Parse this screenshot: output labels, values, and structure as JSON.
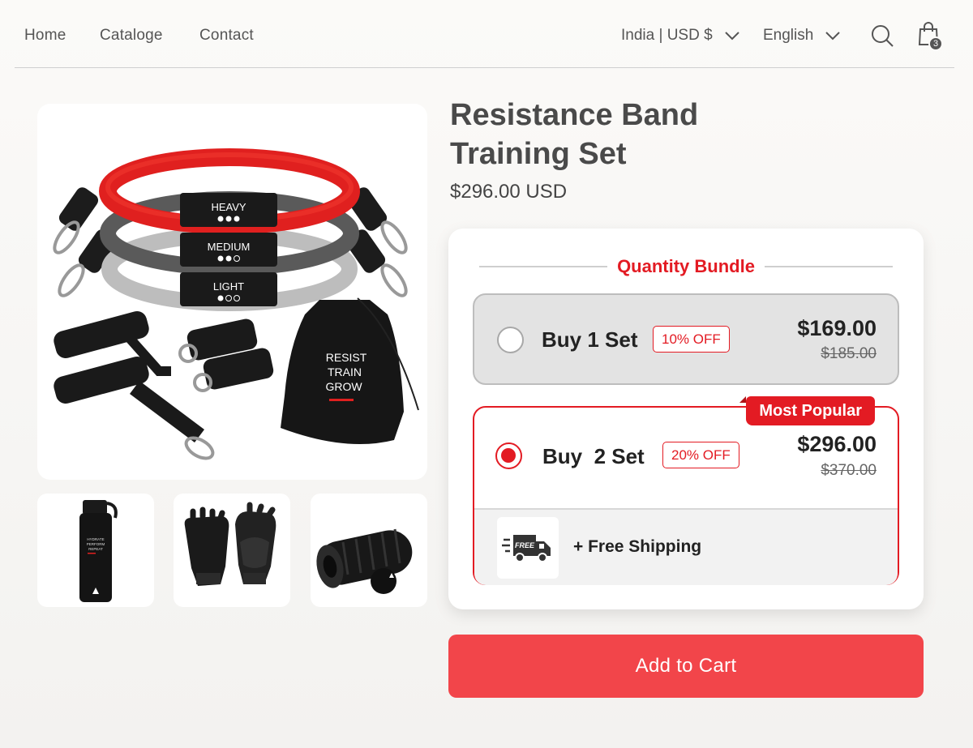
{
  "nav": {
    "links": [
      "Home",
      "Cataloge",
      "Contact"
    ],
    "region": "India | USD $",
    "language": "English",
    "cart_count": "3"
  },
  "gallery": {
    "main_image": "resistance-band-set-image",
    "band_labels": [
      "HEAVY",
      "MEDIUM",
      "LIGHT"
    ],
    "pouch_text": [
      "RESIST",
      "TRAIN",
      "GROW"
    ],
    "bottle_text": [
      "HYDRATE",
      "PERFORM",
      "REPEAT"
    ],
    "thumbnails": [
      "water-bottle-image",
      "gloves-image",
      "foam-roller-image"
    ]
  },
  "product": {
    "title_line1": "Resistance Band",
    "title_line2": "Training Set",
    "price": "$296.00 USD"
  },
  "bundle": {
    "heading": "Quantity Bundle",
    "options": [
      {
        "label": "Buy 1 Set",
        "discount": "10% OFF",
        "price": "$169.00",
        "old_price": "$185.00",
        "selected": false
      },
      {
        "label": "Buy  2 Set",
        "discount": "20% OFF",
        "price": "$296.00",
        "old_price": "$370.00",
        "selected": true,
        "badge": "Most Popular",
        "shipping_icon_text": "FREE",
        "shipping": "+ Free Shipping"
      }
    ]
  },
  "colors": {
    "accent": "#e31b23",
    "button": "#f2454a"
  },
  "add_to_cart": "Add to Cart"
}
